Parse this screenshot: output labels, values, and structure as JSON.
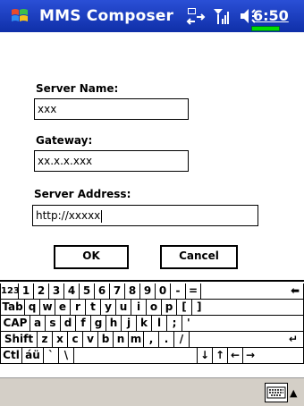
{
  "window": {
    "title": "MMS Composer",
    "time": "6:50"
  },
  "form": {
    "server_name_label": "Server Name:",
    "server_name_value": "xxx",
    "gateway_label": "Gateway:",
    "gateway_value": "xx.x.x.xxx",
    "server_address_label": "Server Address:",
    "server_address_value": "http://xxxxx",
    "ok_label": "OK",
    "cancel_label": "Cancel"
  },
  "keyboard": {
    "rows": [
      [
        "123",
        "1",
        "2",
        "3",
        "4",
        "5",
        "6",
        "7",
        "8",
        "9",
        "0",
        "-",
        "=",
        "⬅"
      ],
      [
        "Tab",
        "q",
        "w",
        "e",
        "r",
        "t",
        "y",
        "u",
        "i",
        "o",
        "p",
        "[",
        "]"
      ],
      [
        "CAP",
        "a",
        "s",
        "d",
        "f",
        "g",
        "h",
        "j",
        "k",
        "l",
        ";",
        "'"
      ],
      [
        "Shift",
        "z",
        "x",
        "c",
        "v",
        "b",
        "n",
        "m",
        ",",
        ".",
        "/",
        "↵"
      ],
      [
        "Ctl",
        "áü",
        "`",
        "\\",
        "",
        "↓",
        "↑",
        "←",
        "→"
      ]
    ]
  },
  "icons": {
    "start": "windows-flag-icon",
    "connectivity": "connectivity-icon",
    "signal": "signal-icon",
    "volume": "volume-icon",
    "input_panel": "keyboard-icon"
  },
  "colors": {
    "titlebar": "#1c3ec4",
    "battery": "#00dd00",
    "bottombar": "#d4cfc7"
  }
}
